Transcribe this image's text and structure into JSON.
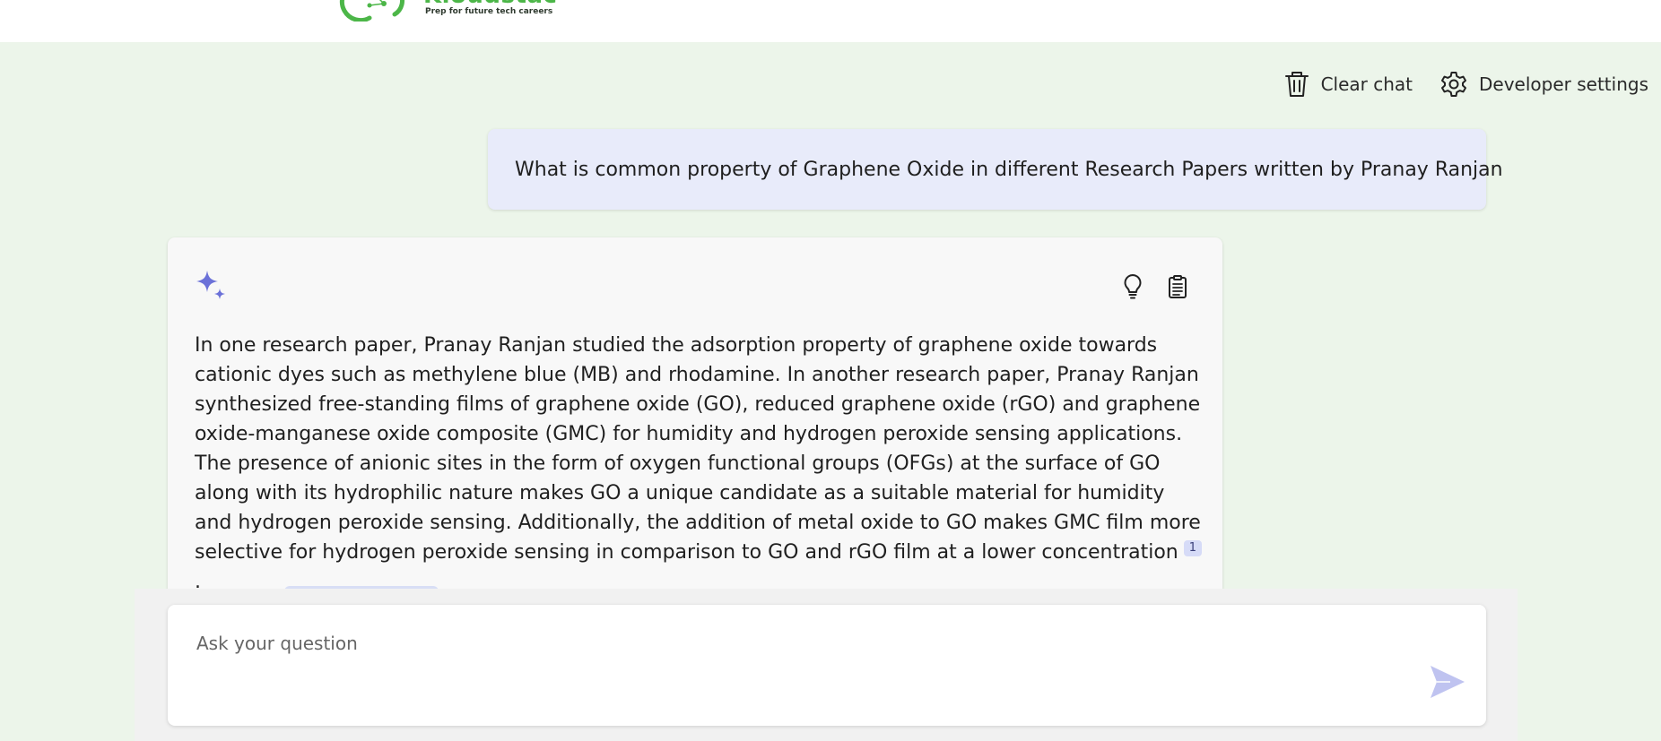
{
  "logo": {
    "name": "Kloudstac",
    "tagline": "Prep for future tech careers"
  },
  "header": {
    "clear_chat_label": "Clear chat",
    "developer_settings_label": "Developer settings"
  },
  "conversation": {
    "user_message": "What is common property of Graphene Oxide in different Research Papers written by Pranay Ranjan",
    "answer": {
      "text": "In one research paper, Pranay Ranjan studied the adsorption property of graphene oxide towards cationic dyes such as methylene blue (MB) and rhodamine. In another research paper, Pranay Ranjan synthesized free-standing films of graphene oxide (GO), reduced graphene oxide (rGO) and graphene oxide-manganese oxide composite (GMC) for humidity and hydrogen peroxide sensing applications. The presence of anionic sites in the form of oxygen functional groups (OFGs) at the surface of GO along with its hydrophilic nature makes GO a unique candidate as a suitable material for humidity and hydrogen peroxide sensing. Additionally, the addition of metal oxide to GO makes GMC film more selective for hydrogen peroxide sensing in comparison to GO and rGO film at a lower concentration",
      "citation": "1",
      "end_punct": "."
    }
  },
  "input": {
    "placeholder": "Ask your question",
    "value": ""
  },
  "icons": {
    "clear": "trash-icon",
    "settings": "gear-icon",
    "answer": "sparkle-icon",
    "thought": "lightbulb-icon",
    "copy": "clipboard-icon",
    "send": "send-icon"
  },
  "colors": {
    "page_bg": "#ecf5ea",
    "brand_green": "#4cb648",
    "user_bubble": "#e8ebfa",
    "accent": "#6b71d8",
    "send_disabled": "#bfc3f0"
  }
}
